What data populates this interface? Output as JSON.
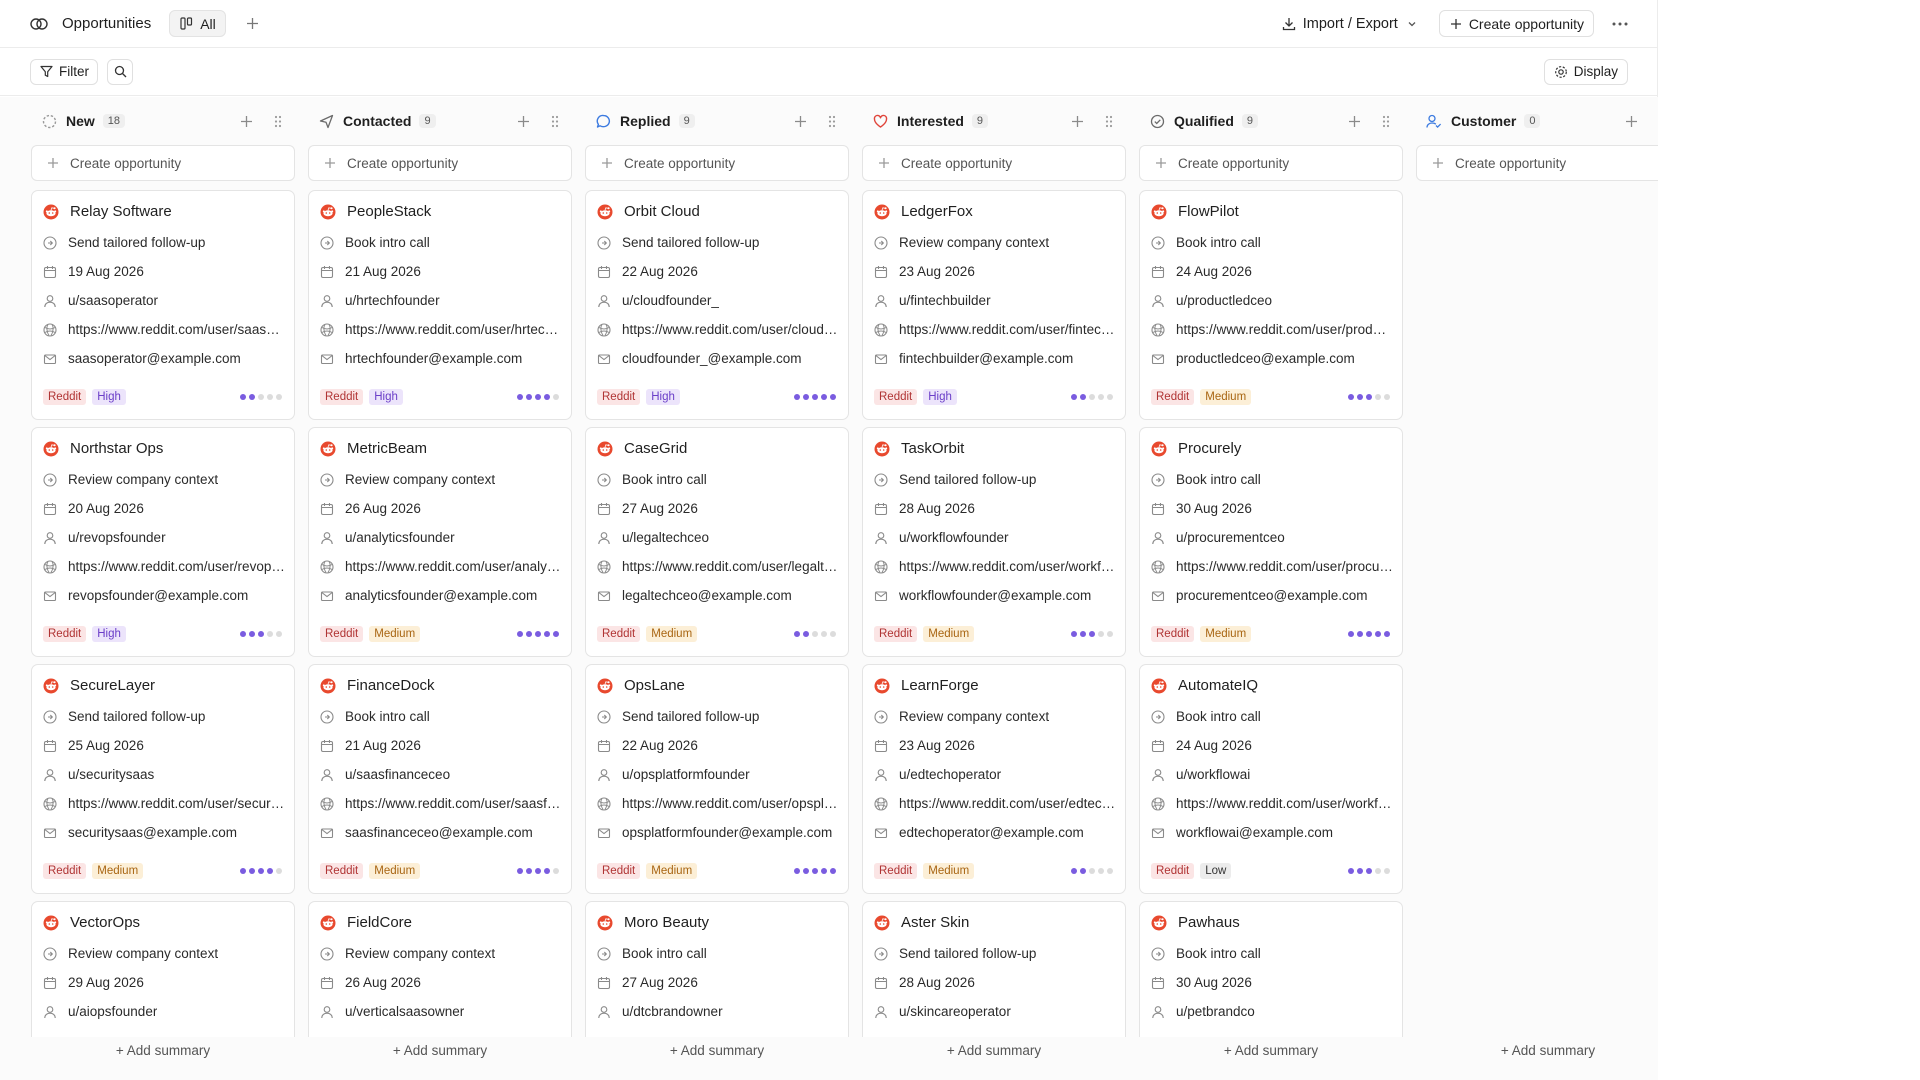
{
  "topbar": {
    "title": "Opportunities",
    "view_label": "All",
    "import_export_label": "Import / Export",
    "create_label": "Create opportunity"
  },
  "toolbar": {
    "filter_label": "Filter",
    "display_label": "Display"
  },
  "board": {
    "create_row_label": "Create opportunity",
    "add_summary_label": "+ Add summary",
    "columns": [
      {
        "name": "New",
        "count": "18",
        "icon": "dashed-circle-icon",
        "icon_color": "#9a9a9a"
      },
      {
        "name": "Contacted",
        "count": "9",
        "icon": "send-icon",
        "icon_color": "#6b6b6b"
      },
      {
        "name": "Replied",
        "count": "9",
        "icon": "chat-bubble-icon",
        "icon_color": "#3d7be0"
      },
      {
        "name": "Interested",
        "count": "9",
        "icon": "heart-icon",
        "icon_color": "#e0453b"
      },
      {
        "name": "Qualified",
        "count": "9",
        "icon": "check-circle-icon",
        "icon_color": "#6b6b6b"
      },
      {
        "name": "Customer",
        "count": "0",
        "icon": "user-check-icon",
        "icon_color": "#3d7be0"
      }
    ]
  },
  "cards": [
    [
      {
        "company": "Relay Software",
        "action": "Send tailored follow-up",
        "date": "19 Aug 2026",
        "user": "u/saasoperator",
        "url": "https://www.reddit.com/user/saasoperator",
        "email": "saasoperator@example.com",
        "source": "Reddit",
        "priority": "High",
        "score": 2
      },
      {
        "company": "Northstar Ops",
        "action": "Review company context",
        "date": "20 Aug 2026",
        "user": "u/revopsfounder",
        "url": "https://www.reddit.com/user/revopsfounder",
        "email": "revopsfounder@example.com",
        "source": "Reddit",
        "priority": "High",
        "score": 3
      },
      {
        "company": "SecureLayer",
        "action": "Send tailored follow-up",
        "date": "25 Aug 2026",
        "user": "u/securitysaas",
        "url": "https://www.reddit.com/user/securitysaas",
        "email": "securitysaas@example.com",
        "source": "Reddit",
        "priority": "Medium",
        "score": 4
      },
      {
        "company": "VectorOps",
        "action": "Review company context",
        "date": "29 Aug 2026",
        "user": "u/aiopsfounder"
      }
    ],
    [
      {
        "company": "PeopleStack",
        "action": "Book intro call",
        "date": "21 Aug 2026",
        "user": "u/hrtechfounder",
        "url": "https://www.reddit.com/user/hrtechfounder",
        "email": "hrtechfounder@example.com",
        "source": "Reddit",
        "priority": "High",
        "score": 4
      },
      {
        "company": "MetricBeam",
        "action": "Review company context",
        "date": "26 Aug 2026",
        "user": "u/analyticsfounder",
        "url": "https://www.reddit.com/user/analyticsfounder",
        "email": "analyticsfounder@example.com",
        "source": "Reddit",
        "priority": "Medium",
        "score": 5
      },
      {
        "company": "FinanceDock",
        "action": "Book intro call",
        "date": "21 Aug 2026",
        "user": "u/saasfinanceceo",
        "url": "https://www.reddit.com/user/saasfinanceceo",
        "email": "saasfinanceceo@example.com",
        "source": "Reddit",
        "priority": "Medium",
        "score": 4
      },
      {
        "company": "FieldCore",
        "action": "Review company context",
        "date": "26 Aug 2026",
        "user": "u/verticalsaasowner"
      }
    ],
    [
      {
        "company": "Orbit Cloud",
        "action": "Send tailored follow-up",
        "date": "22 Aug 2026",
        "user": "u/cloudfounder_",
        "url": "https://www.reddit.com/user/cloudfounder_",
        "email": "cloudfounder_@example.com",
        "source": "Reddit",
        "priority": "High",
        "score": 5
      },
      {
        "company": "CaseGrid",
        "action": "Book intro call",
        "date": "27 Aug 2026",
        "user": "u/legaltechceo",
        "url": "https://www.reddit.com/user/legaltechceo",
        "email": "legaltechceo@example.com",
        "source": "Reddit",
        "priority": "Medium",
        "score": 2
      },
      {
        "company": "OpsLane",
        "action": "Send tailored follow-up",
        "date": "22 Aug 2026",
        "user": "u/opsplatformfounder",
        "url": "https://www.reddit.com/user/opsplatformfounder",
        "email": "opsplatformfounder@example.com",
        "source": "Reddit",
        "priority": "Medium",
        "score": 5
      },
      {
        "company": "Moro Beauty",
        "action": "Book intro call",
        "date": "27 Aug 2026",
        "user": "u/dtcbrandowner"
      }
    ],
    [
      {
        "company": "LedgerFox",
        "action": "Review company context",
        "date": "23 Aug 2026",
        "user": "u/fintechbuilder",
        "url": "https://www.reddit.com/user/fintechbuilder",
        "email": "fintechbuilder@example.com",
        "source": "Reddit",
        "priority": "High",
        "score": 2
      },
      {
        "company": "TaskOrbit",
        "action": "Send tailored follow-up",
        "date": "28 Aug 2026",
        "user": "u/workflowfounder",
        "url": "https://www.reddit.com/user/workflowfounder",
        "email": "workflowfounder@example.com",
        "source": "Reddit",
        "priority": "Medium",
        "score": 3
      },
      {
        "company": "LearnForge",
        "action": "Review company context",
        "date": "23 Aug 2026",
        "user": "u/edtechoperator",
        "url": "https://www.reddit.com/user/edtechoperator",
        "email": "edtechoperator@example.com",
        "source": "Reddit",
        "priority": "Medium",
        "score": 2
      },
      {
        "company": "Aster Skin",
        "action": "Send tailored follow-up",
        "date": "28 Aug 2026",
        "user": "u/skincareoperator"
      }
    ],
    [
      {
        "company": "FlowPilot",
        "action": "Book intro call",
        "date": "24 Aug 2026",
        "user": "u/productledceo",
        "url": "https://www.reddit.com/user/productledceo",
        "email": "productledceo@example.com",
        "source": "Reddit",
        "priority": "Medium",
        "score": 3
      },
      {
        "company": "Procurely",
        "action": "Book intro call",
        "date": "30 Aug 2026",
        "user": "u/procurementceo",
        "url": "https://www.reddit.com/user/procurementceo",
        "email": "procurementceo@example.com",
        "source": "Reddit",
        "priority": "Medium",
        "score": 5
      },
      {
        "company": "AutomateIQ",
        "action": "Book intro call",
        "date": "24 Aug 2026",
        "user": "u/workflowai",
        "url": "https://www.reddit.com/user/workflowai",
        "email": "workflowai@example.com",
        "source": "Reddit",
        "priority": "Low",
        "score": 3
      },
      {
        "company": "Pawhaus",
        "action": "Book intro call",
        "date": "30 Aug 2026",
        "user": "u/petbrandco"
      }
    ],
    []
  ],
  "colors": {
    "accent_dot": "#7a5ce0",
    "reddit": "#e8492e"
  }
}
